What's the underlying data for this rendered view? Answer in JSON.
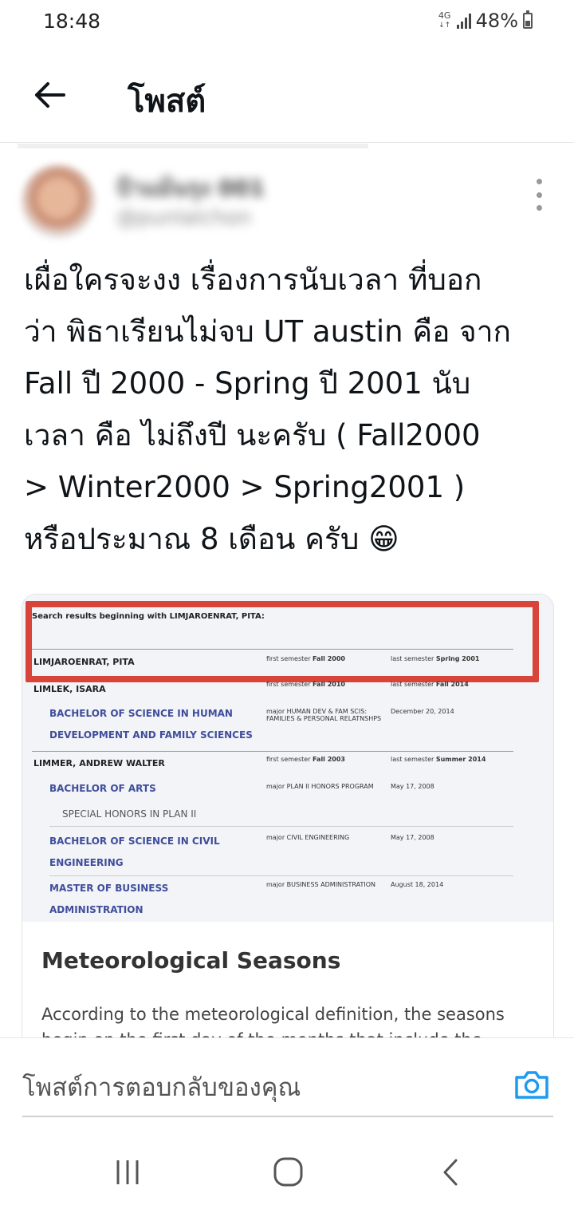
{
  "status_bar": {
    "time": "18:48",
    "network": "4G",
    "battery": "48%",
    "battery_level": 0.48
  },
  "header": {
    "back_icon": "arrow-left-icon",
    "title": "โพสต์"
  },
  "post": {
    "author_name": "ป้าแม้นรุง 001",
    "author_handle": "@punlalchon",
    "text_lines": [
      "เผื่อใครจะงง เรื่องการนับเวลา ที่บอก",
      "ว่า พิธาเรียนไม่จบ UT austin คือ จาก",
      "Fall ปี 2000 - Spring ปี 2001 นับ",
      "เวลา คือ ไม่ถึงปี นะครับ ( Fall2000",
      "> Winter2000 > Spring2001 )",
      "หรือประมาณ 8 เดือน ครับ 😁"
    ],
    "more_icon": "more-vertical-icon"
  },
  "screenshot": {
    "search_header": "Search results beginning with LIMJAROENRAT, PITA:",
    "rows": [
      {
        "name": "LIMJAROENRAT, PITA",
        "first": "first semester",
        "first_val": "Fall 2000",
        "last": "last semester",
        "last_val": "Spring 2001"
      },
      {
        "name": "LIMLEK, ISARA",
        "first": "first semester",
        "first_val": "Fall 2010",
        "last": "last semester",
        "last_val": "Fall 2014"
      },
      {
        "name": "LIMMER, ANDREW WALTER",
        "first": "first semester",
        "first_val": "Fall 2003",
        "last": "last semester",
        "last_val": "Summer 2014"
      }
    ],
    "degrees": [
      {
        "line1": "BACHELOR OF SCIENCE IN HUMAN",
        "line2": "DEVELOPMENT AND FAMILY SCIENCES",
        "major": "major HUMAN DEV & FAM SCIS:",
        "major2": "FAMILIES & PERSONAL RELATNSHPS",
        "date": "December 20, 2014"
      },
      {
        "line1": "BACHELOR OF ARTS",
        "line2": "",
        "major": "major PLAN II HONORS PROGRAM",
        "major2": "",
        "date": "May 17, 2008"
      },
      {
        "line1": "BACHELOR OF SCIENCE IN CIVIL",
        "line2": "ENGINEERING",
        "major": "major CIVIL ENGINEERING",
        "major2": "",
        "date": "May 17, 2008"
      },
      {
        "line1": "MASTER OF BUSINESS",
        "line2": "ADMINISTRATION",
        "major": "major BUSINESS ADMINISTRATION",
        "major2": "",
        "date": "August 18, 2014"
      }
    ],
    "honors": "SPECIAL HONORS IN PLAN II"
  },
  "card": {
    "heading": "Meteorological Seasons",
    "body": "According to the meteorological definition, the seasons begin on the first day of the months that include the equinoxes and"
  },
  "reply": {
    "placeholder": "โพสต์การตอบกลับของคุณ",
    "camera_icon": "camera-icon"
  },
  "nav": {
    "recent_icon": "recent-apps-icon",
    "home_icon": "home-icon",
    "back_icon": "nav-back-icon"
  },
  "colors": {
    "highlight_red": "#d9443a",
    "link_blue": "#3f4d9c",
    "camera_blue": "#1d9bf0"
  }
}
